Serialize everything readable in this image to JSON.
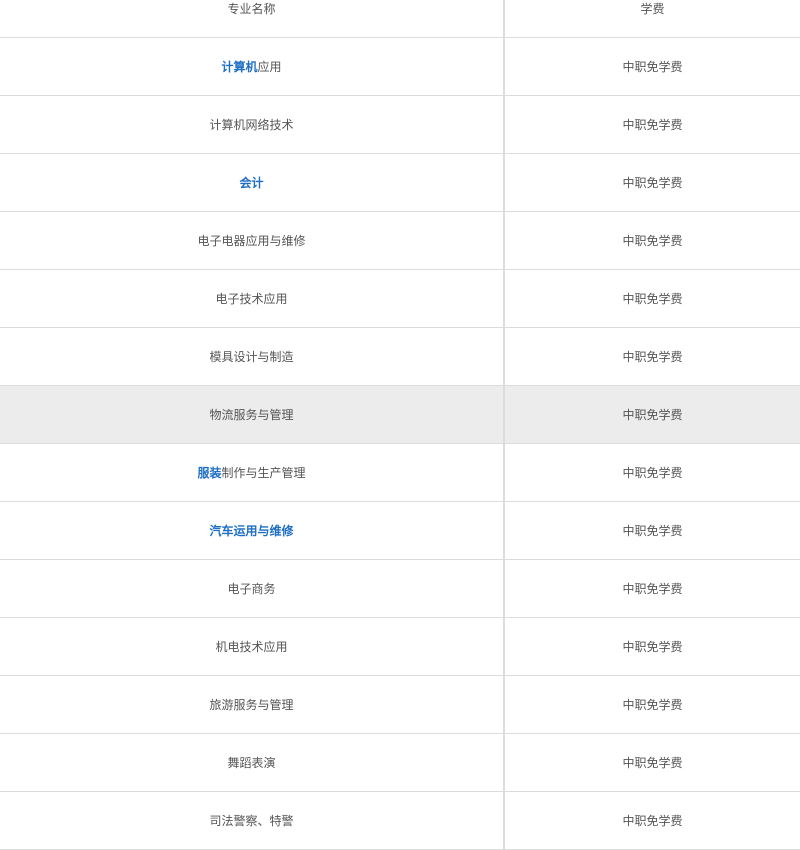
{
  "table": {
    "headers": {
      "name": "专业名称",
      "fee": "学费"
    },
    "rows": [
      {
        "link": "计算机",
        "text": "应用",
        "fee": "中职免学费"
      },
      {
        "link": "",
        "text": "计算机网络技术",
        "fee": "中职免学费"
      },
      {
        "link": "会计",
        "text": "",
        "fee": "中职免学费"
      },
      {
        "link": "",
        "text": "电子电器应用与维修",
        "fee": "中职免学费"
      },
      {
        "link": "",
        "text": "电子技术应用",
        "fee": "中职免学费"
      },
      {
        "link": "",
        "text": "模具设计与制造",
        "fee": "中职免学费"
      },
      {
        "link": "",
        "text": "物流服务与管理",
        "fee": "中职免学费"
      },
      {
        "link": "服装",
        "text": "制作与生产管理",
        "fee": "中职免学费"
      },
      {
        "link": "汽车运用与维修",
        "text": "",
        "fee": "中职免学费"
      },
      {
        "link": "",
        "text": "电子商务",
        "fee": "中职免学费"
      },
      {
        "link": "",
        "text": "机电技术应用",
        "fee": "中职免学费"
      },
      {
        "link": "",
        "text": "旅游服务与管理",
        "fee": "中职免学费"
      },
      {
        "link": "",
        "text": "舞蹈表演",
        "fee": "中职免学费"
      },
      {
        "link": "",
        "text": "司法警察、特警",
        "fee": "中职免学费"
      }
    ]
  },
  "colors": {
    "link": "#1f6fc5",
    "highlight_row": "#ececec",
    "border": "#dcdcdc"
  }
}
